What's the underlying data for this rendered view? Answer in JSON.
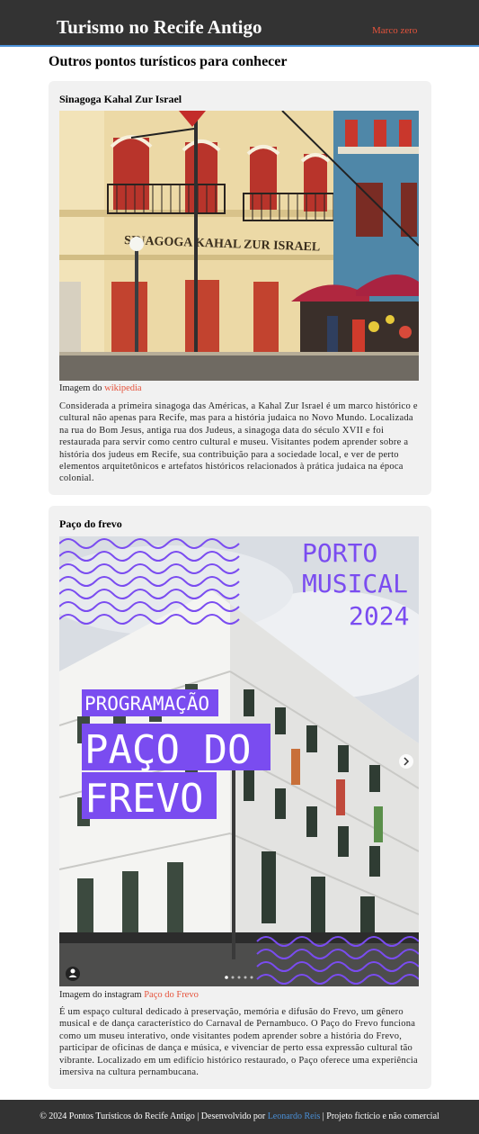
{
  "header": {
    "title": "Turismo no Recife Antigo",
    "nav_link": "Marco zero",
    "colors": {
      "background": "#333333",
      "accent_link": "#e5533c",
      "border": "#4a8fd6"
    }
  },
  "main": {
    "section_title": "Outros pontos turísticos para conhecer",
    "cards": [
      {
        "title": "Sinagoga Kahal Zur Israel",
        "photo_sign_text": "SINAGOGA KAHAL ZUR ISRAEL",
        "caption_prefix": "Imagem do",
        "caption_link": "wikipedia",
        "description": "Considerada a primeira sinagoga das Américas, a Kahal Zur Israel é um marco histórico e cultural não apenas para Recife, mas para a história judaica no Novo Mundo. Localizada na rua do Bom Jesus, antiga rua dos Judeus, a sinagoga data do século XVII e foi restaurada para servir como centro cultural e museu. Visitantes podem aprender sobre a história dos judeus em Recife, sua contribuição para a sociedade local, e ver de perto elementos arquitetônicos e artefatos históricos relacionados à prática judaica na época colonial."
      },
      {
        "title": "Paço do frevo",
        "poster": {
          "top_line1": "PORTO",
          "top_line2": "MUSICAL",
          "top_line3": "2024",
          "tag": "PROGRAMAÇÃO",
          "big_line1": "PAÇO DO",
          "big_line2": "FREVO",
          "purple": "#7a4cf0"
        },
        "caption_prefix": "Imagem do instagram",
        "caption_link": "Paço do Frevo",
        "description": "É um espaço cultural dedicado à preservação, memória e difusão do Frevo, um gênero musical e de dança característico do Carnaval de Pernambuco. O Paço do Frevo funciona como um museu interativo, onde visitantes podem aprender sobre a história do Frevo, participar de oficinas de dança e música, e vivenciar de perto essa expressão cultural tão vibrante. Localizado em um edifício histórico restaurado, o Paço oferece uma experiência imersiva na cultura pernambucana."
      }
    ]
  },
  "footer": {
    "text_before": "© 2024 Pontos Turísticos do Recife Antigo | Desenvolvido por",
    "author_link": "Leonardo Reis",
    "text_after": "| Projeto fictício e não comercial"
  }
}
